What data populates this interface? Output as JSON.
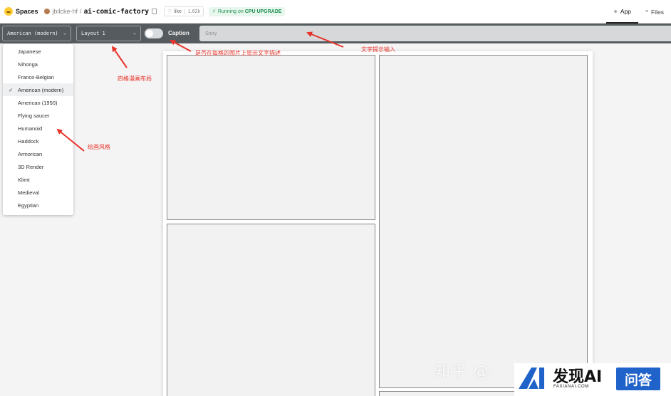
{
  "topbar": {
    "spaces_label": "Spaces",
    "owner": "jbilcke-hf",
    "separator": "/",
    "repo": "ai-comic-factory",
    "like_label": "like",
    "like_count": "1.62k",
    "status_prefix": "Running on",
    "status_hardware": "CPU UPGRADE",
    "tabs": [
      {
        "label": "App",
        "icon": "app-icon"
      },
      {
        "label": "Files",
        "icon": "files-icon"
      }
    ]
  },
  "toolbar": {
    "style_select": "American (modern)",
    "layout_select": "Layout 1",
    "caption_label": "Caption",
    "caption_enabled": false,
    "story_placeholder": "Story"
  },
  "style_dropdown": {
    "items": [
      {
        "label": "Japanese",
        "selected": false
      },
      {
        "label": "Nihonga",
        "selected": false
      },
      {
        "label": "Franco-Belgian",
        "selected": false
      },
      {
        "label": "American (modern)",
        "selected": true
      },
      {
        "label": "American (1950)",
        "selected": false
      },
      {
        "label": "Flying saucer",
        "selected": false
      },
      {
        "label": "Humanoid",
        "selected": false
      },
      {
        "label": "Haddock",
        "selected": false
      },
      {
        "label": "Armorican",
        "selected": false
      },
      {
        "label": "3D Render",
        "selected": false
      },
      {
        "label": "Klimt",
        "selected": false
      },
      {
        "label": "Medieval",
        "selected": false
      },
      {
        "label": "Egyptian",
        "selected": false
      }
    ]
  },
  "annotations": {
    "layout": "四格漫画布局",
    "caption": "是否在每格的图片上显示文字描述",
    "story": "文字提示输入",
    "style": "绘画风格"
  },
  "watermark": {
    "text": "知乎 @...",
    "brand": "发现AI",
    "brand_sub": "FAXIANAI.COM",
    "button": "问答"
  },
  "colors": {
    "toolbar_bg": "#555b5f",
    "annotation_red": "#e8332a",
    "status_green": "#1f8f50",
    "watermark_blue": "#1f62c9"
  }
}
